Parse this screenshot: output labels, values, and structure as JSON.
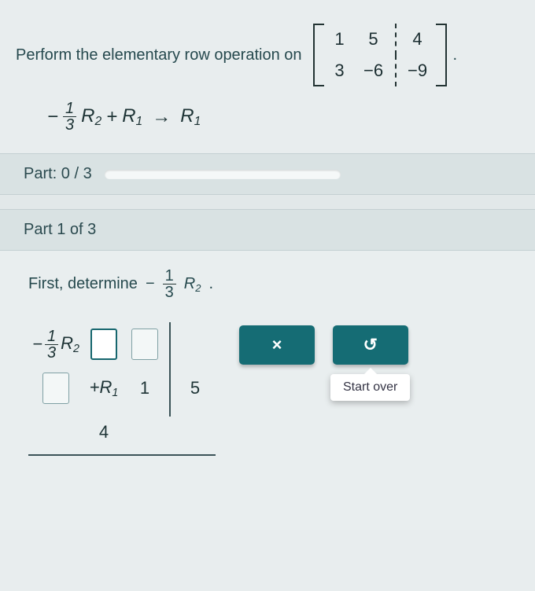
{
  "problem": {
    "prompt": "Perform the elementary row operation on",
    "matrix": {
      "r1": [
        "1",
        "5",
        "4"
      ],
      "r2": [
        "3",
        "−6",
        "−9"
      ]
    },
    "op_coef_num": "1",
    "op_coef_den": "3",
    "op_sign": "−",
    "op_r2": "R",
    "op_r2_sub": "2",
    "op_plus": "+",
    "op_r1": "R",
    "op_r1_sub": "1",
    "op_arrow": "→",
    "op_target": "R",
    "op_target_sub": "1"
  },
  "progress": {
    "label": "Part: 0 / 3"
  },
  "part": {
    "header": "Part 1 of 3",
    "first_text": "First, determine",
    "expr_sign": "−",
    "expr_num": "1",
    "expr_den": "3",
    "expr_R": "R",
    "expr_sub": "2",
    "expr_period": ".",
    "row1_label_sign": "−",
    "row1_label_num": "1",
    "row1_label_den": "3",
    "row1_label_R": "R",
    "row1_label_sub": "2",
    "row2_label_plus": "+",
    "row2_label_R": "R",
    "row2_label_sub": "1",
    "row2_vals": [
      "1",
      "5",
      "4"
    ]
  },
  "buttons": {
    "close": "×",
    "reset": "↺",
    "tooltip": "Start over"
  }
}
